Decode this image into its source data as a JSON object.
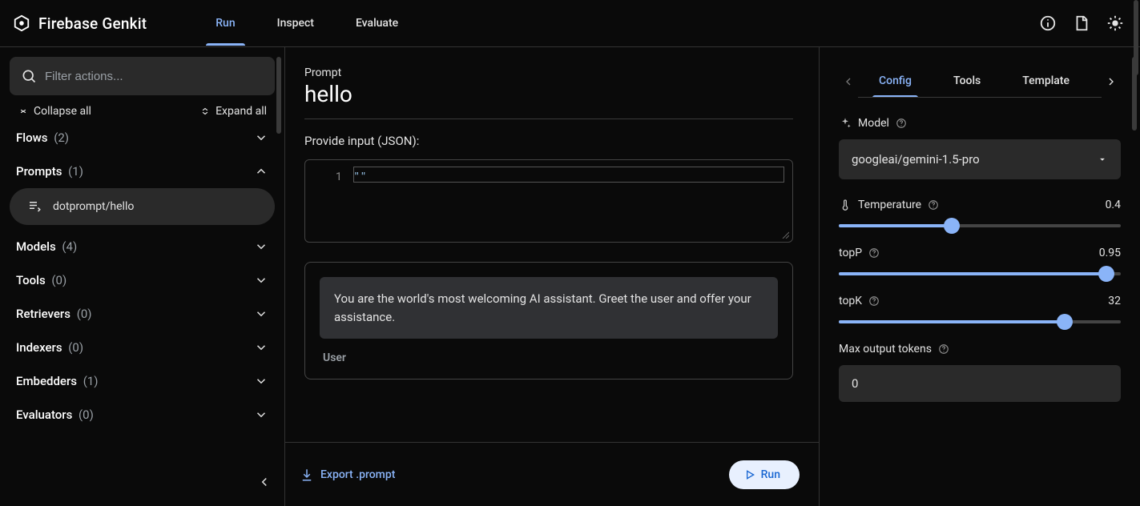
{
  "header": {
    "brand": "Firebase Genkit",
    "tabs": [
      "Run",
      "Inspect",
      "Evaluate"
    ],
    "active_tab": 0
  },
  "sidebar": {
    "search_placeholder": "Filter actions...",
    "collapse_all": "Collapse all",
    "expand_all": "Expand all",
    "sections": [
      {
        "label": "Flows",
        "count": "(2)",
        "expanded": false
      },
      {
        "label": "Prompts",
        "count": "(1)",
        "expanded": true,
        "items": [
          {
            "icon": "prompt-icon",
            "label": "dotprompt/hello"
          }
        ]
      },
      {
        "label": "Models",
        "count": "(4)",
        "expanded": false
      },
      {
        "label": "Tools",
        "count": "(0)",
        "expanded": false
      },
      {
        "label": "Retrievers",
        "count": "(0)",
        "expanded": false
      },
      {
        "label": "Indexers",
        "count": "(0)",
        "expanded": false
      },
      {
        "label": "Embedders",
        "count": "(1)",
        "expanded": false
      },
      {
        "label": "Evaluators",
        "count": "(0)",
        "expanded": false
      }
    ]
  },
  "main": {
    "section_label": "Prompt",
    "title": "hello",
    "input_label": "Provide input (JSON):",
    "code": {
      "line_no": "1",
      "content": "\"\""
    },
    "assistant_message": "You are the world's most welcoming AI assistant. Greet the user and offer your assistance.",
    "user_label": "User",
    "export_label": "Export .prompt",
    "run_label": "Run"
  },
  "config": {
    "tabs": [
      "Config",
      "Tools",
      "Template"
    ],
    "active_tab": 0,
    "model_label": "Model",
    "model_value": "googleai/gemini-1.5-pro",
    "temperature_label": "Temperature",
    "temperature_value": "0.4",
    "temperature_pct": 40,
    "topP_label": "topP",
    "topP_value": "0.95",
    "topP_pct": 95,
    "topK_label": "topK",
    "topK_value": "32",
    "topK_pct": 80,
    "max_tokens_label": "Max output tokens",
    "max_tokens_value": "0"
  }
}
